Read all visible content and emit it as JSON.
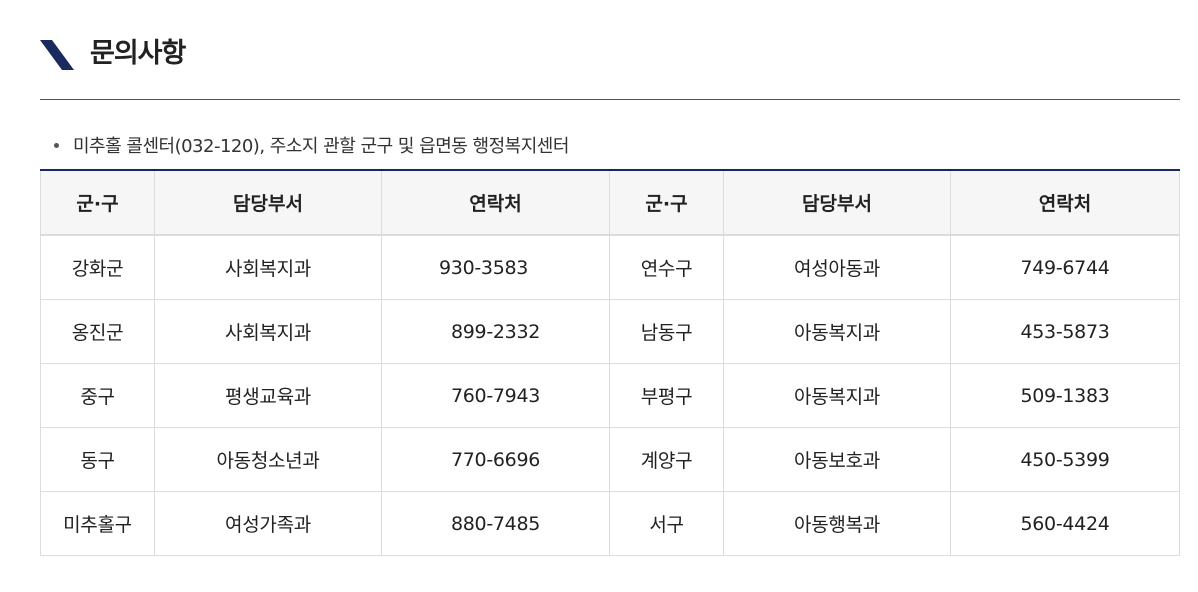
{
  "section": {
    "title": "문의사항",
    "accent_color": "#1b2a5e"
  },
  "notice": {
    "text": "미추홀 콜센터(032-120), 주소지 관할 군구 및 읍면동 행정복지센터"
  },
  "table": {
    "headers": [
      "군·구",
      "담당부서",
      "연락처",
      "군·구",
      "담당부서",
      "연락처"
    ],
    "rows": [
      [
        "강화군",
        "사회복지과",
        "930-3583",
        "연수구",
        "여성아동과",
        "749-6744"
      ],
      [
        "옹진군",
        "사회복지과",
        "899-2332",
        "남동구",
        "아동복지과",
        "453-5873"
      ],
      [
        "중구",
        "평생교육과",
        "760-7943",
        "부평구",
        "아동복지과",
        "509-1383"
      ],
      [
        "동구",
        "아동청소년과",
        "770-6696",
        "계양구",
        "아동보호과",
        "450-5399"
      ],
      [
        "미추홀구",
        "여성가족과",
        "880-7485",
        "서구",
        "아동행복과",
        "560-4424"
      ]
    ]
  }
}
